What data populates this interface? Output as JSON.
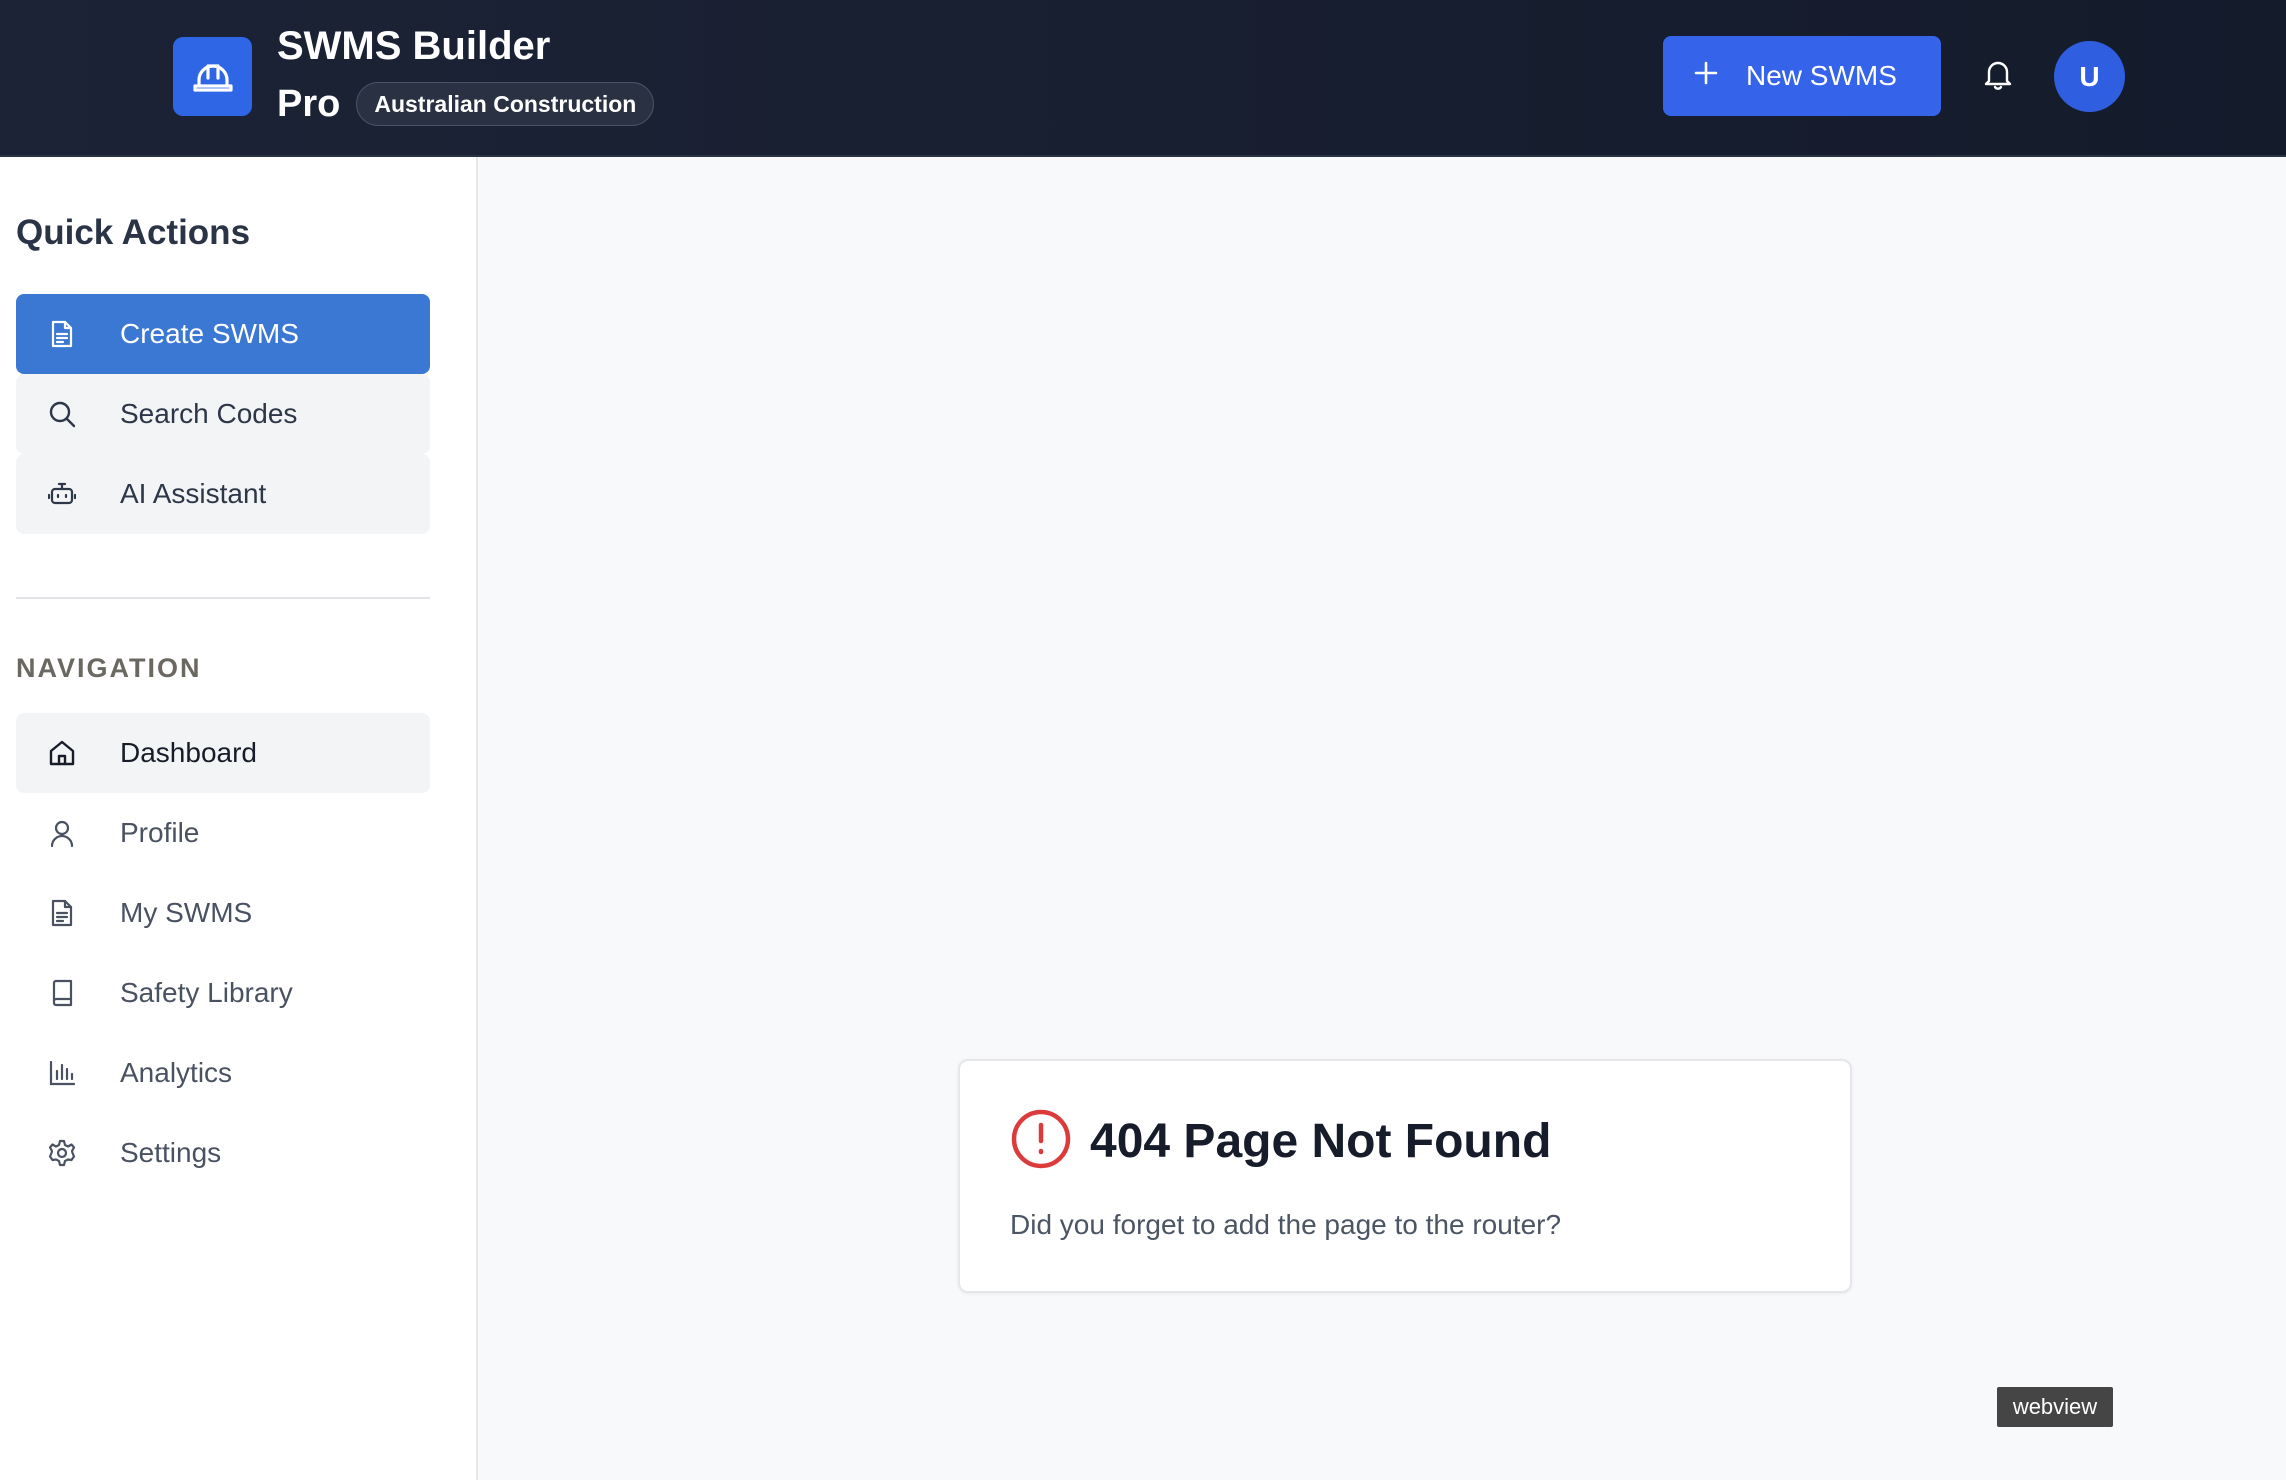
{
  "header": {
    "logo_icon": "hard-hat-icon",
    "title": "SWMS Builder",
    "title_suffix": "Pro",
    "region_badge": "Australian Construction",
    "new_button_label": "New SWMS",
    "new_button_icon": "plus-icon",
    "notifications_icon": "bell-icon",
    "avatar_initial": "U",
    "accent_color": "#3563e9"
  },
  "sidebar": {
    "quick_actions_title": "Quick Actions",
    "quick_actions": [
      {
        "label": "Create SWMS",
        "icon": "document-icon",
        "active": true
      },
      {
        "label": "Search Codes",
        "icon": "search-icon",
        "active": false
      },
      {
        "label": "AI Assistant",
        "icon": "bot-icon",
        "active": false
      }
    ],
    "navigation_title": "NAVIGATION",
    "navigation": [
      {
        "label": "Dashboard",
        "icon": "home-icon",
        "current": true
      },
      {
        "label": "Profile",
        "icon": "user-icon",
        "current": false
      },
      {
        "label": "My SWMS",
        "icon": "document-icon",
        "current": false
      },
      {
        "label": "Safety Library",
        "icon": "book-icon",
        "current": false
      },
      {
        "label": "Analytics",
        "icon": "bar-chart-icon",
        "current": false
      },
      {
        "label": "Settings",
        "icon": "gear-icon",
        "current": false
      }
    ]
  },
  "main": {
    "error_icon": "alert-circle-icon",
    "error_title": "404 Page Not Found",
    "error_message": "Did you forget to add the page to the router?",
    "error_color": "#dc3b3b"
  },
  "overlay": {
    "webview_label": "webview"
  }
}
